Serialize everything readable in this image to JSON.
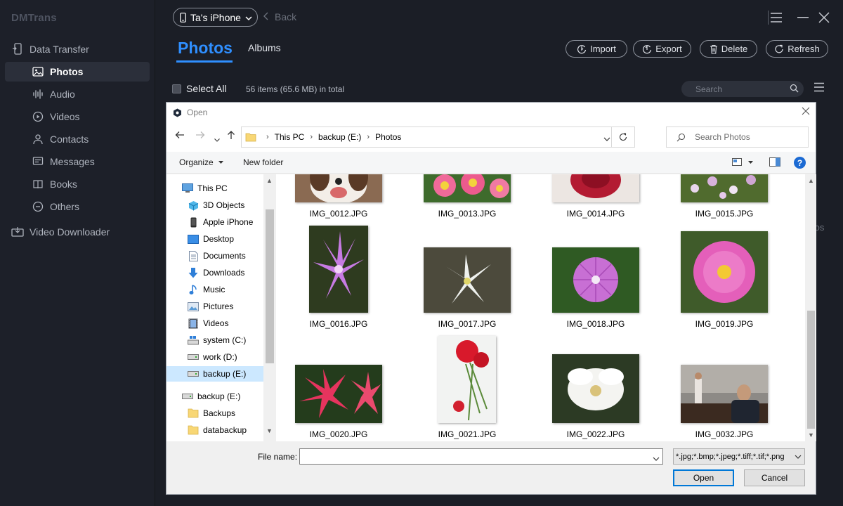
{
  "app": {
    "brand": "DMTrans"
  },
  "sidebar": {
    "data_transfer": "Data Transfer",
    "items": [
      {
        "label": "Photos",
        "icon": "photos-icon"
      },
      {
        "label": "Audio",
        "icon": "audio-icon"
      },
      {
        "label": "Videos",
        "icon": "videos-icon"
      },
      {
        "label": "Contacts",
        "icon": "contacts-icon"
      },
      {
        "label": "Messages",
        "icon": "messages-icon"
      },
      {
        "label": "Books",
        "icon": "books-icon"
      },
      {
        "label": "Others",
        "icon": "others-icon"
      }
    ],
    "video_downloader": "Video Downloader"
  },
  "header": {
    "device": "Ta's iPhone",
    "back": "Back",
    "tab_photos": "Photos",
    "tab_albums": "Albums",
    "import": "Import",
    "export": "Export",
    "delete": "Delete",
    "refresh": "Refresh"
  },
  "toolbar": {
    "select_all": "Select All",
    "count": "56 items (65.6 MB) in total",
    "search_placeholder": "Search",
    "behind_fragment": "tos"
  },
  "dialog": {
    "title": "Open",
    "path": [
      "This PC",
      "backup (E:)",
      "Photos"
    ],
    "search_placeholder": "Search Photos",
    "organize": "Organize",
    "new_folder": "New folder",
    "help": "?",
    "tree": [
      {
        "label": "This PC"
      },
      {
        "label": "3D Objects"
      },
      {
        "label": "Apple iPhone"
      },
      {
        "label": "Desktop"
      },
      {
        "label": "Documents"
      },
      {
        "label": "Downloads"
      },
      {
        "label": "Music"
      },
      {
        "label": "Pictures"
      },
      {
        "label": "Videos"
      },
      {
        "label": "system (C:)"
      },
      {
        "label": "work (D:)"
      },
      {
        "label": "backup (E:)"
      },
      {
        "label": "backup (E:)"
      },
      {
        "label": "Backups"
      },
      {
        "label": "databackup"
      }
    ],
    "files": [
      "IMG_0012.JPG",
      "IMG_0013.JPG",
      "IMG_0014.JPG",
      "IMG_0015.JPG",
      "IMG_0016.JPG",
      "IMG_0017.JPG",
      "IMG_0018.JPG",
      "IMG_0019.JPG",
      "IMG_0020.JPG",
      "IMG_0021.JPG",
      "IMG_0022.JPG",
      "IMG_0032.JPG"
    ],
    "file_name_label": "File name:",
    "file_name_value": "",
    "file_type": "*.jpg;*.bmp;*.jpeg;*.tiff;*.tif;*.png",
    "open": "Open",
    "cancel": "Cancel"
  },
  "colors": {
    "accent": "#2f8fff",
    "app_bg": "#1b1e26",
    "dialog_bg": "#f0f0f0"
  }
}
